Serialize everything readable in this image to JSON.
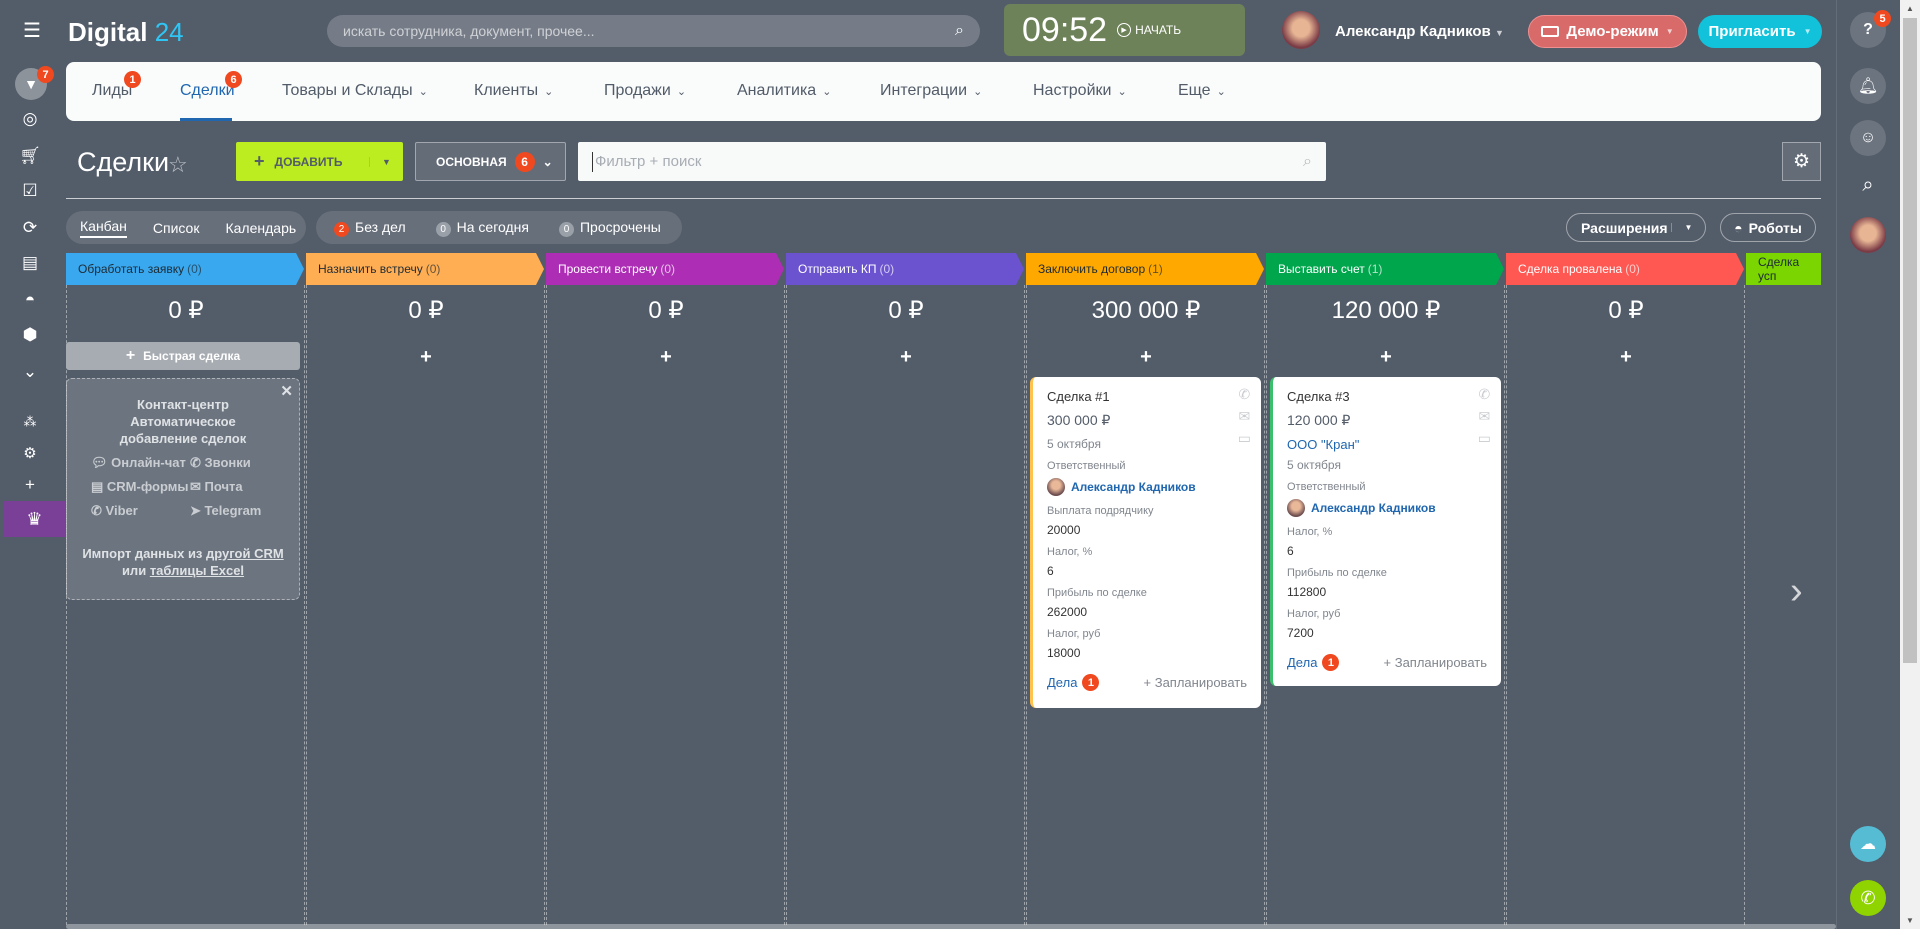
{
  "topbar": {
    "logo_main": "Digital",
    "logo_num": "24",
    "search_placeholder": "искать сотрудника, документ, прочее...",
    "time": "09:52",
    "start_label": "НАЧАТЬ",
    "user_name": "Александр Кадников",
    "demo_label": "Демо-режим",
    "invite_label": "Пригласить"
  },
  "left_sidebar": {
    "crm_badge": "7"
  },
  "nav": {
    "items": [
      {
        "label": "Лиды",
        "badge": "1"
      },
      {
        "label": "Сделки",
        "badge": "6"
      },
      {
        "label": "Товары и Склады"
      },
      {
        "label": "Клиенты"
      },
      {
        "label": "Продажи"
      },
      {
        "label": "Аналитика"
      },
      {
        "label": "Интеграции"
      },
      {
        "label": "Настройки"
      },
      {
        "label": "Еще"
      }
    ]
  },
  "toolbar": {
    "title": "Сделки",
    "add_label": "ДОБАВИТЬ",
    "preset_label": "ОСНОВНАЯ",
    "preset_count": "6",
    "filter_placeholder": "Фильтр + поиск",
    "views": [
      "Канбан",
      "Список",
      "Календарь"
    ],
    "counters": [
      {
        "count": "2",
        "label": "Без дел"
      },
      {
        "count": "0",
        "label": "На сегодня"
      },
      {
        "count": "0",
        "label": "Просрочены"
      }
    ],
    "extensions_label": "Расширения",
    "robots_label": "Роботы"
  },
  "right_sidebar": {
    "help_badge": "5"
  },
  "columns": [
    {
      "title": "Обработать заявку",
      "count": "(0)",
      "sum": "0 ₽",
      "color": "#39a8ef",
      "text": "#1d2a33"
    },
    {
      "title": "Назначить встречу",
      "count": "(0)",
      "sum": "0 ₽",
      "color": "#ffae53",
      "text": "#1d2a33"
    },
    {
      "title": "Провести встречу",
      "count": "(0)",
      "sum": "0 ₽",
      "color": "#ad2eb5",
      "text": "#ffffff"
    },
    {
      "title": "Отправить КП",
      "count": "(0)",
      "sum": "0 ₽",
      "color": "#6b52cf",
      "text": "#ffffff"
    },
    {
      "title": "Заключить договор",
      "count": "(1)",
      "sum": "300 000 ₽",
      "color": "#ffa900",
      "text": "#1d2a33"
    },
    {
      "title": "Выставить счет",
      "count": "(1)",
      "sum": "120 000 ₽",
      "color": "#00a64c",
      "text": "#ffffff"
    },
    {
      "title": "Сделка провалена",
      "count": "(0)",
      "sum": "0 ₽",
      "color": "#ff5752",
      "text": "#ffffff"
    },
    {
      "title": "Сделка усп",
      "count": "",
      "sum": "",
      "color": "#7bd500",
      "text": "#1d2a33"
    }
  ],
  "quick_deal_label": "Быстрая сделка",
  "contact_center": {
    "title1": "Контакт-центр",
    "title2": "Автоматическое добавление сделок",
    "channels": [
      "Онлайн-чат",
      "Звонки",
      "CRM-формы",
      "Почта",
      "Viber",
      "Telegram"
    ],
    "import_prefix": "Импорт данных из",
    "import_link1": "другой CRM",
    "import_mid": "или",
    "import_link2": "таблицы Excel"
  },
  "cards": [
    {
      "title": "Сделка #1",
      "sum": "300 000 ₽",
      "date": "5 октября",
      "resp_label": "Ответственный",
      "resp": "Александр Кадников",
      "fields": [
        {
          "label": "Выплата подрядчику",
          "value": "20000"
        },
        {
          "label": "Налог, %",
          "value": "6"
        },
        {
          "label": "Прибыль по сделке",
          "value": "262000"
        },
        {
          "label": "Налог, руб",
          "value": "18000"
        }
      ],
      "tasks_label": "Дела",
      "tasks_count": "1",
      "plan_label": "+ Запланировать"
    },
    {
      "title": "Сделка #3",
      "sum": "120 000 ₽",
      "company": "ООО \"Кран\"",
      "date": "5 октября",
      "resp_label": "Ответственный",
      "resp": "Александр Кадников",
      "fields": [
        {
          "label": "Налог, %",
          "value": "6"
        },
        {
          "label": "Прибыль по сделке",
          "value": "112800"
        },
        {
          "label": "Налог, руб",
          "value": "7200"
        }
      ],
      "tasks_label": "Дела",
      "tasks_count": "1",
      "plan_label": "+ Запланировать"
    }
  ]
}
